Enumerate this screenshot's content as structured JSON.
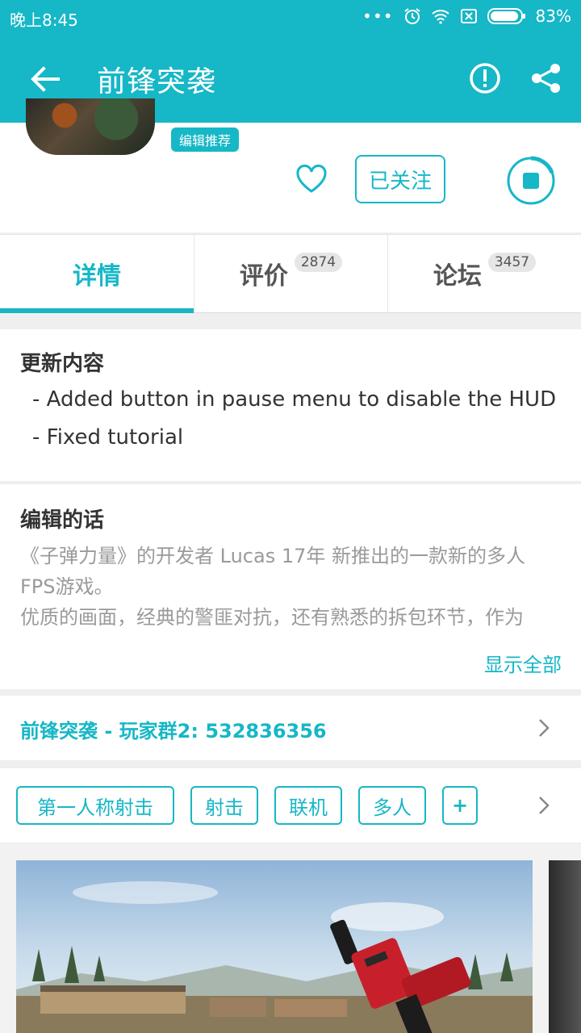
{
  "status_bar": {
    "time": "晚上8:45",
    "battery": "83%"
  },
  "app_bar": {
    "title": "前锋突袭"
  },
  "header": {
    "badge": "编辑推荐",
    "follow_label": "已关注"
  },
  "tabs": [
    {
      "label": "详情",
      "count": ""
    },
    {
      "label": "评价",
      "count": "2874"
    },
    {
      "label": "论坛",
      "count": "3457"
    }
  ],
  "update": {
    "title": "更新内容",
    "lines": [
      "- Added button in pause menu to disable the HUD",
      "- Fixed tutorial"
    ]
  },
  "editor": {
    "title": "编辑的话",
    "lines": [
      "《子弹力量》的开发者 Lucas 17年 新推出的一款新的多人",
      "FPS游戏。",
      "优质的画面，经典的警匪对抗，还有熟悉的拆包环节，作为"
    ],
    "show_all": "显示全部"
  },
  "group": {
    "text": "前锋突袭 - 玩家群2:  532836356"
  },
  "tags": [
    "第一人称射击",
    "射击",
    "联机",
    "多人",
    "+"
  ],
  "colors": {
    "accent": "#16b7c6"
  }
}
